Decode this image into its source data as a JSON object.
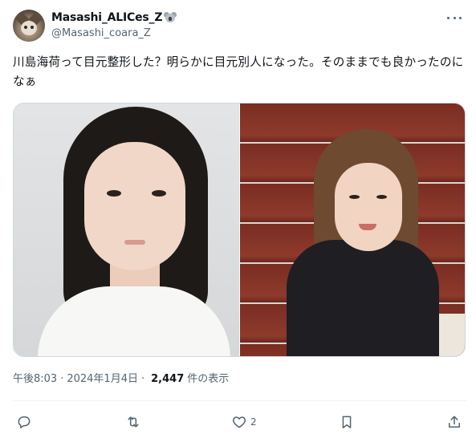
{
  "author": {
    "display_name": "Masashi_ALICes_Z",
    "badge_icon": "koala-emoji",
    "handle": "@Masashi_coara_Z"
  },
  "tweet": {
    "text": "川島海荷って目元整形した？明らかに目元別人になった。そのままでも良かったのになぁ",
    "images": [
      {
        "icon": "portrait-photo-young"
      },
      {
        "icon": "portrait-photo-adult"
      }
    ]
  },
  "meta": {
    "time": "午後8:03",
    "date": "2024年1月4日",
    "separator": "·",
    "views_count": "2,447",
    "views_label": "件の表示"
  },
  "actions": {
    "reply": {
      "icon": "reply-icon",
      "count": ""
    },
    "retweet": {
      "icon": "retweet-icon",
      "count": ""
    },
    "like": {
      "icon": "heart-icon",
      "count": "2"
    },
    "bookmark": {
      "icon": "bookmark-icon",
      "count": ""
    },
    "share": {
      "icon": "share-icon",
      "count": ""
    }
  },
  "colors": {
    "text_primary": "#0f1419",
    "text_secondary": "#536471",
    "border": "#cfd9de",
    "divider": "#eff3f4"
  }
}
